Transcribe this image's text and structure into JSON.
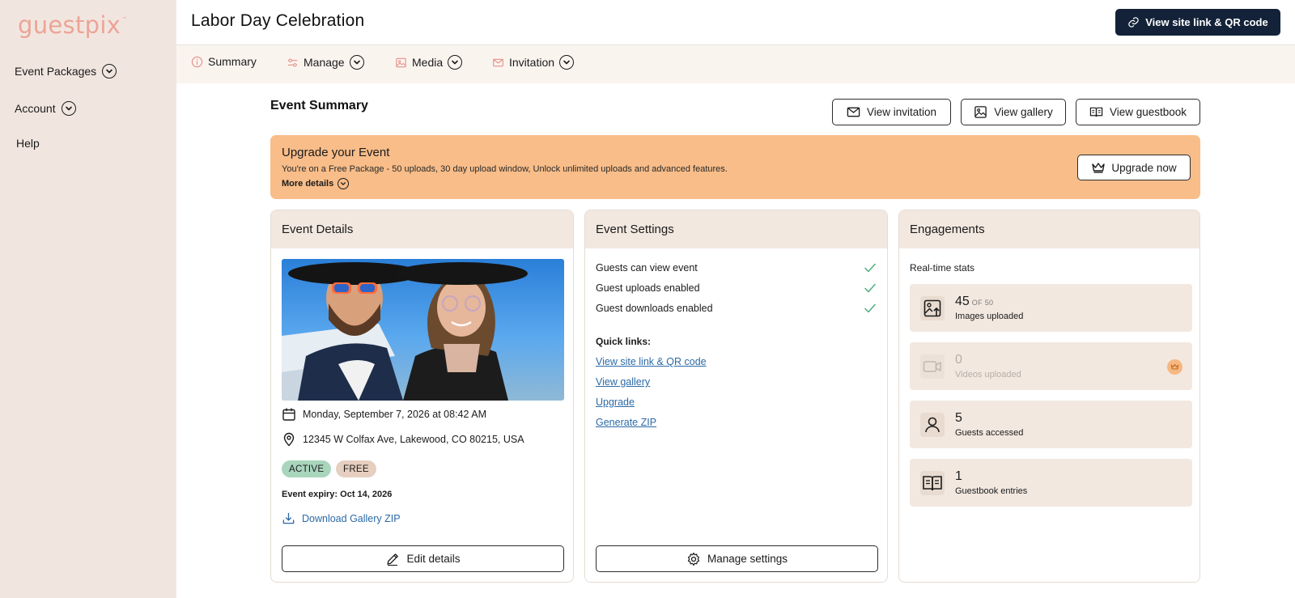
{
  "brand": {
    "logo_text": "guestpix",
    "logo_mark": "™",
    "logo_color": "#eba497"
  },
  "sidebar": {
    "items": [
      {
        "label": "Event Packages",
        "icon": "chevron-down-circle-icon"
      },
      {
        "label": "Account",
        "icon": "chevron-down-circle-icon"
      },
      {
        "label": "Help"
      }
    ]
  },
  "header": {
    "title": "Labor Day Celebration",
    "site_link_button": "View site link & QR code"
  },
  "tabs": [
    {
      "label": "Summary",
      "icon": "info-circle-icon"
    },
    {
      "label": "Manage",
      "icon": "sliders-icon"
    },
    {
      "label": "Media",
      "icon": "image-icon"
    },
    {
      "label": "Invitation",
      "icon": "mail-icon"
    }
  ],
  "summary": {
    "title": "Event Summary",
    "buttons": {
      "view_invitation": "View invitation",
      "view_gallery": "View gallery",
      "view_guestbook": "View guestbook"
    }
  },
  "banner": {
    "title": "Upgrade your Event",
    "description": "You're on a Free Package - 50 uploads, 30 day upload window, Unlock unlimited uploads and advanced features.",
    "more_details": "More details",
    "upgrade_button": "Upgrade now",
    "color": "#f8bd89"
  },
  "event_details": {
    "title": "Event Details",
    "date": "Monday, September 7, 2026 at 08:42 AM",
    "address": "12345 W Colfax Ave, Lakewood, CO 80215, USA",
    "badges": {
      "status": "ACTIVE",
      "plan": "FREE"
    },
    "expiry": "Event expiry: Oct 14, 2026",
    "download": "Download Gallery ZIP",
    "edit_button": "Edit details"
  },
  "event_settings": {
    "title": "Event Settings",
    "settings": [
      {
        "label": "Guests can view event",
        "enabled": true
      },
      {
        "label": "Guest uploads enabled",
        "enabled": true
      },
      {
        "label": "Guest downloads enabled",
        "enabled": true
      }
    ],
    "quick_links_title": "Quick links:",
    "quick_links": [
      "View site link & QR code",
      "View gallery",
      "Upgrade",
      "Generate ZIP"
    ],
    "manage_button": "Manage settings"
  },
  "engagements": {
    "title": "Engagements",
    "subtitle": "Real-time stats",
    "stats": [
      {
        "value": "45",
        "suffix": "OF 50",
        "label": "Images uploaded",
        "icon": "image-upload-icon"
      },
      {
        "value": "0",
        "label": "Videos uploaded",
        "icon": "video-icon",
        "locked": true
      },
      {
        "value": "5",
        "label": "Guests accessed",
        "icon": "user-icon"
      },
      {
        "value": "1",
        "label": "Guestbook entries",
        "icon": "guestbook-icon"
      }
    ]
  },
  "colors": {
    "sidebar_bg": "#f1e6df",
    "primary_dark": "#132238",
    "link": "#2b6aa6",
    "check_green": "#4caf7d",
    "badge_active_bg": "#a8d5bc",
    "badge_free_bg": "#e6cfc0"
  }
}
